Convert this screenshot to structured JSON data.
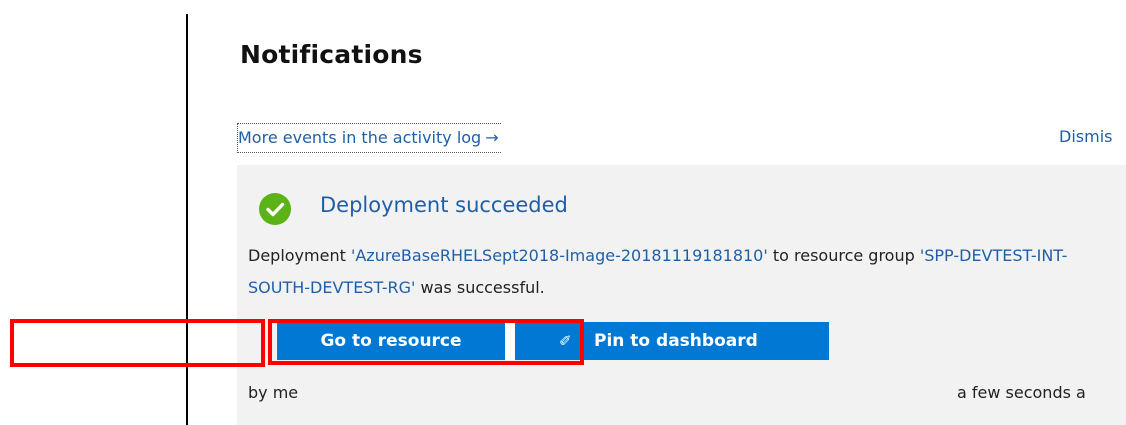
{
  "panel": {
    "title": "Notifications",
    "activity_link": "More events in the activity log",
    "activity_arrow": "→",
    "dismiss": "Dismis"
  },
  "notification": {
    "status_icon": "checkmark-circle-icon",
    "status_color": "#5bb318",
    "title": "Deployment succeeded",
    "message_prefix": "Deployment ",
    "deployment_name": "'AzureBaseRHELSept2018-Image-20181119181810'",
    "message_mid": " to resource group ",
    "resource_group": "'SPP-DEVTEST-INT-SOUTH-DEVTEST-RG'",
    "message_suffix": " was successful.",
    "author": "by me",
    "timestamp": "a few seconds a"
  },
  "actions": {
    "go_to_resource": "Go to resource",
    "pin_icon": "pin-icon",
    "pin_to_dashboard": "Pin to dashboard",
    "button_color": "#0078d4"
  },
  "annotations": {
    "highlight_color": "#ff0000"
  }
}
